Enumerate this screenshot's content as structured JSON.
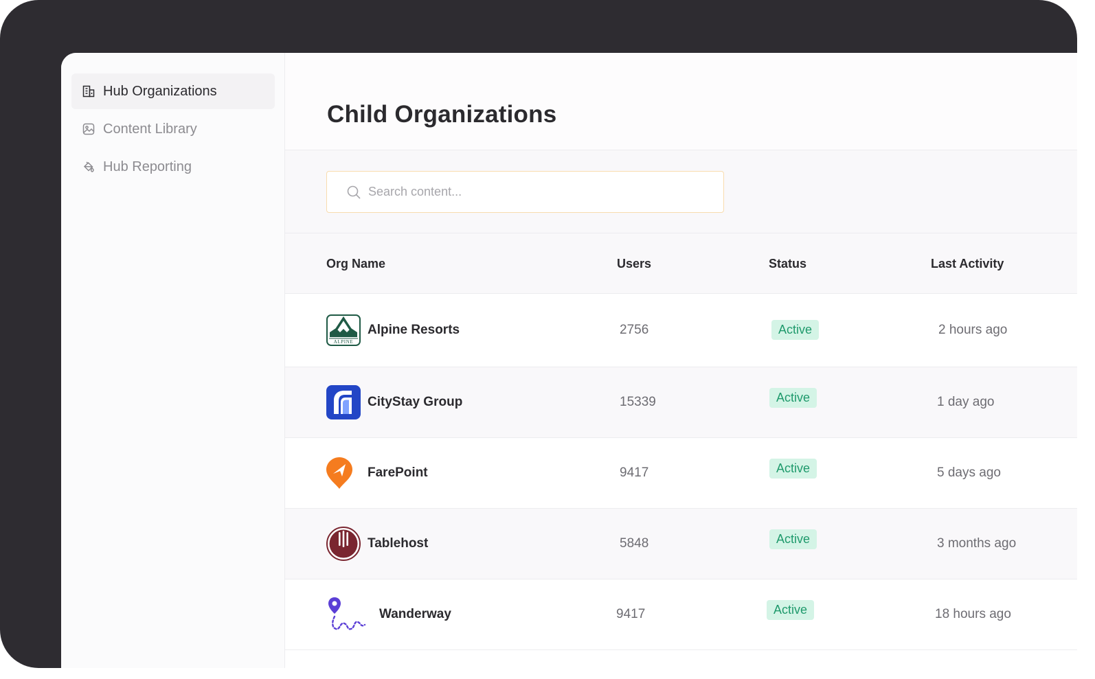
{
  "sidebar": {
    "items": [
      {
        "label": "Hub Organizations",
        "icon": "building-icon",
        "active": true
      },
      {
        "label": "Content Library",
        "icon": "image-icon",
        "active": false
      },
      {
        "label": "Hub Reporting",
        "icon": "paint-bucket-icon",
        "active": false
      }
    ]
  },
  "main": {
    "title": "Child Organizations",
    "search": {
      "placeholder": "Search content...",
      "value": ""
    },
    "table": {
      "columns": [
        "Org Name",
        "Users",
        "Status",
        "Last Activity"
      ],
      "rows": [
        {
          "name": "Alpine Resorts",
          "users": "2756",
          "status": "Active",
          "last_activity": "2 hours ago",
          "logo": "alpine-logo"
        },
        {
          "name": "CityStay Group",
          "users": "15339",
          "status": "Active",
          "last_activity": "1 day ago",
          "logo": "citystay-logo"
        },
        {
          "name": "FarePoint",
          "users": "9417",
          "status": "Active",
          "last_activity": "5 days ago",
          "logo": "farepoint-logo"
        },
        {
          "name": "Tablehost",
          "users": "5848",
          "status": "Active",
          "last_activity": "3 months ago",
          "logo": "tablehost-logo"
        },
        {
          "name": "Wanderway",
          "users": "9417",
          "status": "Active",
          "last_activity": "18 hours ago",
          "logo": "wanderway-logo"
        }
      ]
    }
  },
  "logos": {
    "alpine_wordmark": "ALPINE"
  },
  "colors": {
    "device_frame": "#2e2c31",
    "search_border": "#f8dcae",
    "badge_bg": "#d4f4e6",
    "badge_text": "#1f9a6c",
    "alpine_green": "#1f5a45",
    "citystay_blue": "#2346c6",
    "farepoint_orange": "#f57c1f",
    "tablehost_maroon": "#7a2630",
    "wanderway_purple": "#5b3fd6"
  }
}
